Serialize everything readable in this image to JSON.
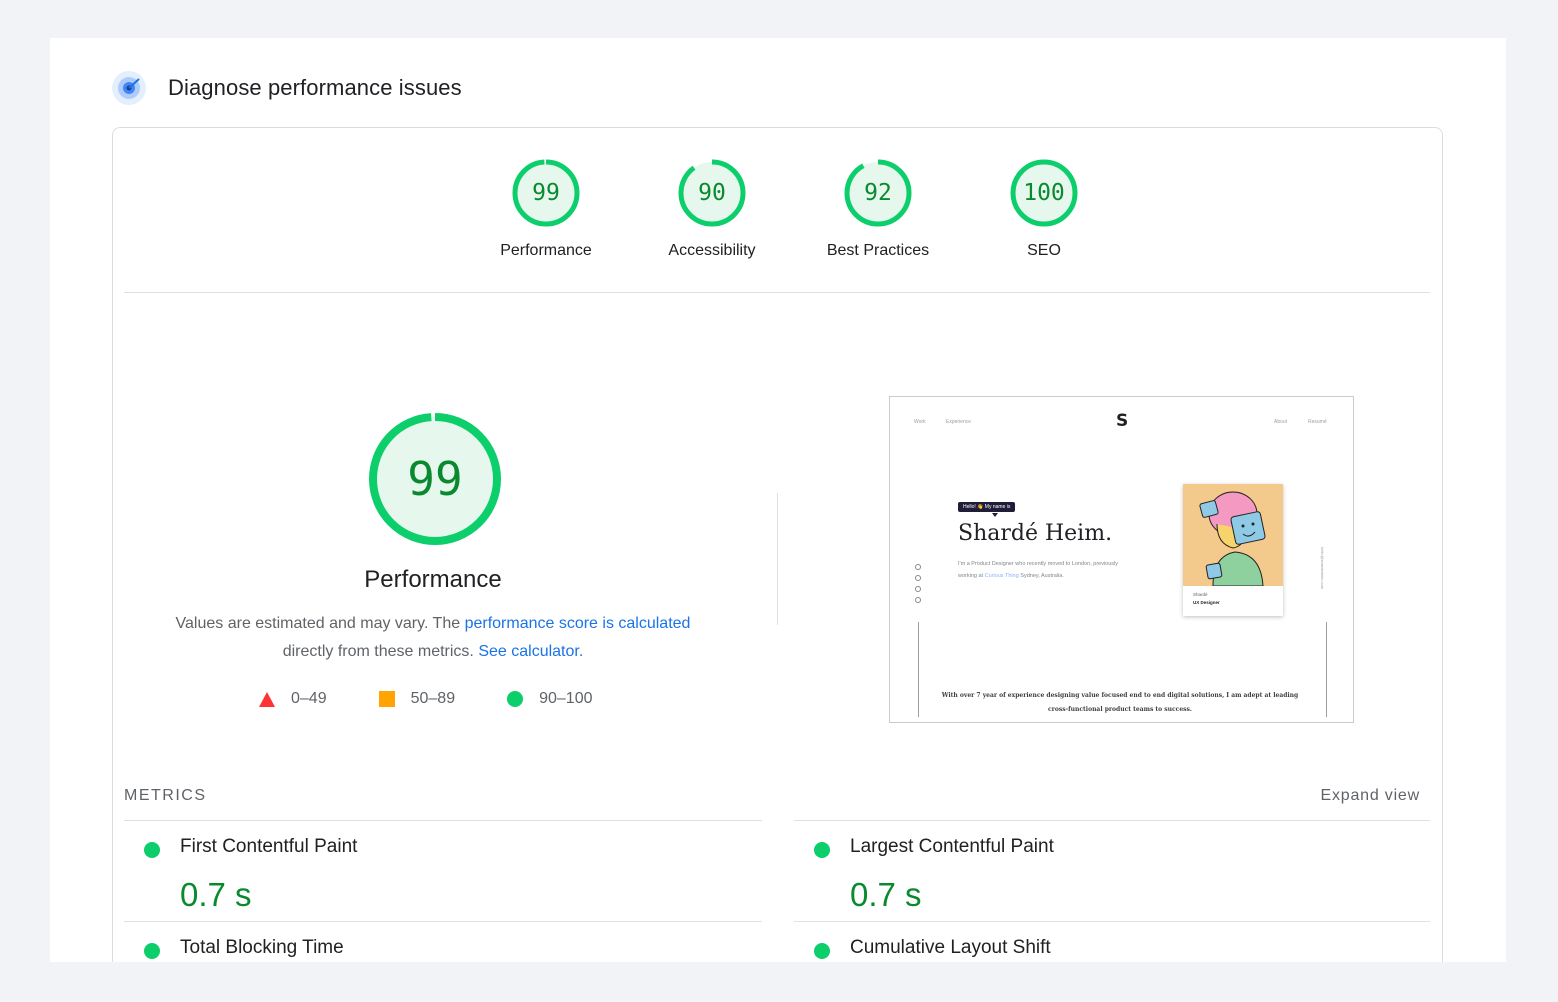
{
  "header": {
    "title": "Diagnose performance issues",
    "icon": "lighthouse-icon"
  },
  "gauges": [
    {
      "score": "99",
      "label": "Performance",
      "fraction": 0.99
    },
    {
      "score": "90",
      "label": "Accessibility",
      "fraction": 0.9
    },
    {
      "score": "92",
      "label": "Best Practices",
      "fraction": 0.92
    },
    {
      "score": "100",
      "label": "SEO",
      "fraction": 1.0
    }
  ],
  "performance": {
    "score": "99",
    "fraction": 0.99,
    "title": "Performance",
    "desc_prefix": "Values are estimated and may vary. The ",
    "desc_link1": "performance score is calculated",
    "desc_middle": " directly from these metrics. ",
    "desc_link2": "See calculator."
  },
  "legend": [
    {
      "range": "0–49",
      "shape": "triangle",
      "color": "#ff3333"
    },
    {
      "range": "50–89",
      "shape": "square",
      "color": "#ffa400"
    },
    {
      "range": "90–100",
      "shape": "circle",
      "color": "#0cce6b"
    }
  ],
  "screenshot": {
    "nav_left": [
      "Work",
      "Experience"
    ],
    "nav_right": [
      "About",
      "Resumé"
    ],
    "logo": "S",
    "hello_tag": "Hello! 👋 My name is",
    "hero_name": "Shardé Heim.",
    "intro_prefix": "I'm a Product Designer who recently moved to London, previously working at ",
    "intro_link": "Curious Thing",
    "intro_suffix": " Sydney, Australia.",
    "card_name": "Shardé",
    "card_role": "UX Designer",
    "side_email": "hello@shardeheim.com",
    "bottom_text": "With over 7 year of experience designing value focused end to end digital solutions, I am adept at leading cross-functional product teams to success."
  },
  "metrics": {
    "title": "METRICS",
    "expand_label": "Expand view",
    "items": [
      {
        "name": "First Contentful Paint",
        "value": "0.7 s"
      },
      {
        "name": "Largest Contentful Paint",
        "value": "0.7 s"
      },
      {
        "name": "Total Blocking Time",
        "value": ""
      },
      {
        "name": "Cumulative Layout Shift",
        "value": ""
      }
    ]
  },
  "colors": {
    "pass": "#0cce6b",
    "pass_text": "#0a8a2e",
    "pass_bg": "#e6f8ee",
    "link": "#1a73e8"
  }
}
